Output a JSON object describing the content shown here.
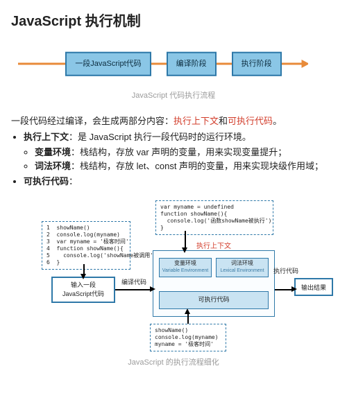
{
  "title": "JavaScript 执行机制",
  "flow1": {
    "stages": [
      "一段JavaScript代码",
      "编译阶段",
      "执行阶段"
    ],
    "caption": "JavaScript 代码执行流程",
    "arrow_color": "#e88b3a"
  },
  "para": {
    "lead_a": "一段代码经过编译，会生成两部分内容：",
    "lead_red1": "执行上下文",
    "lead_mid": "和",
    "lead_red2": "可执行代码",
    "lead_end": "。"
  },
  "bullets": {
    "ctx_label": "执行上下文",
    "ctx_desc": "：是 JavaScript 执行一段代码时的运行环境。",
    "var_label": "变量环境",
    "var_desc": "：栈结构，存放 var 声明的变量，用来实现变量提升；",
    "lex_label": "词法环境",
    "lex_desc": "：栈结构，存放 let、const 声明的变量，用来实现块级作用域；",
    "exe_label": "可执行代码",
    "exe_desc": "："
  },
  "dia": {
    "code_top": "var myname = undefined\nfunction showName(){\n  console.log('函数showName被执行')\n}",
    "code_left": "1  showName()\n2  console.log(myname)\n3  var myname = '极客时间'\n4  function showName(){\n5    console.log('showName被调用')\n6  }",
    "code_bottom": "showName()\nconsole.log(myname)\nmyname = '极客时间'",
    "input_box": "输入一段\nJavaScript代码",
    "output_box": "输出结果",
    "compile_label": "编译代码",
    "exec_label": "执行代码",
    "ctx_title": "执行上下文",
    "var_env_cn": "变量环境",
    "var_env_en": "Variable Environment",
    "lex_env_cn": "词法环境",
    "lex_env_en": "Lexical Environment",
    "exe_code": "可执行代码",
    "caption": "JavaScript 的执行流程细化"
  }
}
